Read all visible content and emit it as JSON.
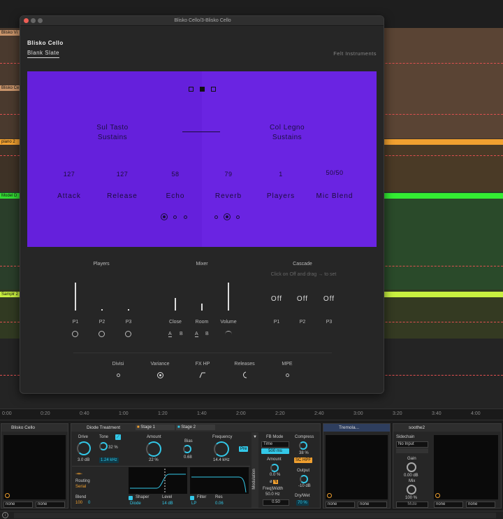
{
  "window_title": "Blisko Cello/3-Blisko Cello",
  "plugin": {
    "brand": "Blisko Cello",
    "preset": "Blank Slate",
    "maker": "Felt Instruments",
    "left_articulation": [
      "Sul Tasto",
      "Sustains"
    ],
    "right_articulation": [
      "Col Legno",
      "Sustains"
    ],
    "params": [
      {
        "value": "127",
        "label": "Attack"
      },
      {
        "value": "127",
        "label": "Release"
      },
      {
        "value": "58",
        "label": "Echo"
      },
      {
        "value": "79",
        "label": "Reverb"
      },
      {
        "value": "1",
        "label": "Players"
      },
      {
        "value": "50/50",
        "label": "Mic Blend"
      }
    ],
    "players_title": "Players",
    "players": [
      "P1",
      "P2",
      "P3"
    ],
    "player_levels": [
      1.0,
      0.05,
      0.05
    ],
    "mixer_title": "Mixer",
    "mixer": [
      "Close",
      "Room",
      "Volume"
    ],
    "mixer_levels": [
      0.45,
      0.25,
      1.0
    ],
    "ab": [
      "A",
      "B",
      "A",
      "B"
    ],
    "cascade_title": "Cascade",
    "cascade_hint": "Click on Off and drag → to set",
    "cascade_values": [
      "Off",
      "Off",
      "Off"
    ],
    "cascade_players": [
      "P1",
      "P2",
      "P3"
    ],
    "bottom": [
      {
        "label": "Divisi",
        "state": "off"
      },
      {
        "label": "Variance",
        "state": "on"
      },
      {
        "label": "FX HP",
        "state": "hp"
      },
      {
        "label": "Releases",
        "state": "moon"
      },
      {
        "label": "MPE",
        "state": "off"
      }
    ],
    "colors": {
      "purple": "#6520dc",
      "panel": "#262626"
    }
  },
  "daw": {
    "tracks": [
      {
        "name": "Blisko Vi",
        "color": "#c8946a"
      },
      {
        "name": "Blisko Ce",
        "color": "#c8946a"
      },
      {
        "name": "piano 2",
        "color": "#f0a030"
      },
      {
        "name": "Model D",
        "color": "#33dd33"
      },
      {
        "name": "Samplr 2",
        "color": "#c8f040"
      }
    ],
    "timeline": [
      "0:00",
      "0:20",
      "0:40",
      "1:00",
      "1:20",
      "1:40",
      "2:00",
      "2:20",
      "2:40",
      "3:00",
      "3:20",
      "3:40",
      "4:00"
    ]
  },
  "devices": {
    "blisko": {
      "name": "Blisko Cello",
      "outputs": [
        "none",
        "none"
      ]
    },
    "diode": {
      "name": "Diode Treatment",
      "tabs": [
        "Stage 1",
        "Stage 2"
      ],
      "drive_label": "Drive",
      "drive_value": "3.0 dB",
      "tone_label": "Tone",
      "tone_value": "32 %",
      "tone_freq": "1.24 kHz",
      "amount_label": "Amount",
      "amount_value": "22 %",
      "bias_label": "Bias",
      "bias_value": "0.68",
      "freq_label": "Frequency",
      "freq_value": "14.4 kHz",
      "pre_label": "Pre",
      "routing_label": "Routing",
      "routing_value": "Serial",
      "blend_label": "Blend",
      "blend_values": [
        "100",
        "0"
      ],
      "shaper_label": "Shaper",
      "shaper_value": "Diode",
      "level_label": "Level",
      "level_value": "14 dB",
      "filter_label": "Filter",
      "filter_value": "LP",
      "res_label": "Res",
      "res_value": "0.06",
      "fbmode_label": "FB Mode",
      "fbmode_value": "Time",
      "fbtime": "500 ms",
      "fbamount_label": "Amount",
      "fbamount_value": "0.0 %",
      "freqwidth_label": "Freq|Width",
      "freqwidth_value": "50.0 Hz",
      "width_value": "0.50",
      "compress_label": "Compress",
      "compress_value": "38 %",
      "schpf": "SC HPF",
      "output_label": "Output",
      "output_value": "-10 dB",
      "drywet_label": "Dry/Wet",
      "drywet_value": "70 %",
      "modulation_label": "Modulation"
    },
    "tremolo": {
      "name": "Tremola...",
      "outputs": [
        "none",
        "none"
      ]
    },
    "soothe": {
      "name": "soothe2",
      "sidechain_label": "Sidechain",
      "sidechain_value": "No Input",
      "gain_label": "Gain",
      "gain_value": "0.00 dB",
      "mix_label": "Mix",
      "mix_value": "100 %",
      "mute_label": "Mute",
      "outputs": [
        "none",
        "none"
      ]
    }
  }
}
